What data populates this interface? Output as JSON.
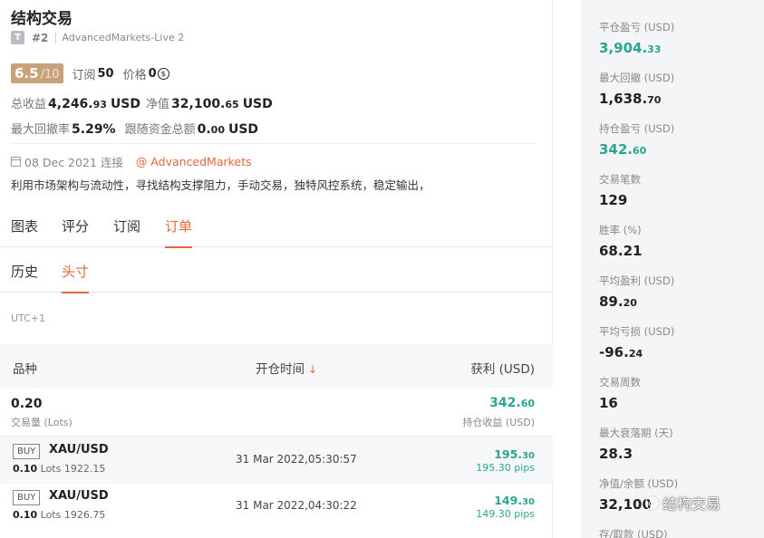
{
  "header": {
    "title": "结构交易",
    "badge": "T",
    "account_num": "#2",
    "server": "AdvancedMarkets-Live 2"
  },
  "rating": {
    "score": "6.5",
    "max": "/10",
    "subscribe_label": "订阅",
    "subscribe_count": "50",
    "price_label": "价格",
    "price_value": "0",
    "price_icon": "coin-icon"
  },
  "metrics": {
    "total_profit_label": "总收益",
    "total_profit_main": "4,246.",
    "total_profit_dec": "93",
    "total_profit_unit": "USD",
    "equity_label": "净值",
    "equity_main": "32,100.",
    "equity_dec": "65",
    "equity_unit": "USD",
    "max_dd_label": "最大回撤率",
    "max_dd_value": "5.29%",
    "follow_label": "跟随资金总额",
    "follow_main": "0.",
    "follow_dec": "00",
    "follow_unit": "USD"
  },
  "info": {
    "connected": "08 Dec 2021 连接",
    "broker": "@ AdvancedMarkets",
    "description": "利用市场架构与流动性，寻找结构支撑阻力，手动交易，独特风控系统，稳定输出，"
  },
  "tabs": [
    {
      "label": "图表"
    },
    {
      "label": "评分"
    },
    {
      "label": "订阅"
    },
    {
      "label": "订单"
    }
  ],
  "subtabs": [
    {
      "label": "历史"
    },
    {
      "label": "头寸"
    }
  ],
  "timezone": "UTC+1",
  "table": {
    "headers": {
      "symbol": "品种",
      "open_time": "开仓时间",
      "sort_arrow": "↓",
      "profit": "获利 (USD)"
    },
    "summary": {
      "lots": "0.20",
      "lots_label": "交易量 (Lots)",
      "profit_main": "342.",
      "profit_dec": "60",
      "profit_label": "持仓收益 (USD)"
    },
    "rows": [
      {
        "side": "BUY",
        "symbol": "XAU/USD",
        "lots": "0.10",
        "lots_unit": "Lots",
        "price": "1922.15",
        "time": "31 Mar 2022,05:30:57",
        "profit_main": "195.",
        "profit_dec": "30",
        "pips": "195.30 pips"
      },
      {
        "side": "BUY",
        "symbol": "XAU/USD",
        "lots": "0.10",
        "lots_unit": "Lots",
        "price": "1926.75",
        "time": "31 Mar 2022,04:30:22",
        "profit_main": "149.",
        "profit_dec": "30",
        "pips": "149.30 pips"
      }
    ]
  },
  "sidebar": {
    "stats": [
      {
        "label": "平仓盈亏 (USD)",
        "main": "3,904.",
        "dec": "33",
        "green": true
      },
      {
        "label": "最大回撤 (USD)",
        "main": "1,638.",
        "dec": "70",
        "green": false
      },
      {
        "label": "持仓盈亏 (USD)",
        "main": "342.",
        "dec": "60",
        "green": true
      },
      {
        "label": "交易笔数",
        "main": "129",
        "dec": "",
        "green": false
      },
      {
        "label": "胜率 (%)",
        "main": "68.21",
        "dec": "",
        "green": false
      },
      {
        "label": "平均盈利 (USD)",
        "main": "89.",
        "dec": "20",
        "green": false
      },
      {
        "label": "平均亏损 (USD)",
        "main": "-96.",
        "dec": "24",
        "green": false
      },
      {
        "label": "交易周数",
        "main": "16",
        "dec": "",
        "green": false
      },
      {
        "label": "最大衰落期 (天)",
        "main": "28.3",
        "dec": "",
        "green": false
      },
      {
        "label": "净值/余额 (USD)",
        "main": "32,100",
        "dec": "",
        "green": false
      },
      {
        "label": "存/取款 (USD)",
        "main": "",
        "dec": "",
        "green": false
      }
    ]
  },
  "watermark": "结构交易",
  "colors": {
    "accent": "#e4663a",
    "green": "#2aa58f",
    "rating_bg": "#c8a27a"
  }
}
